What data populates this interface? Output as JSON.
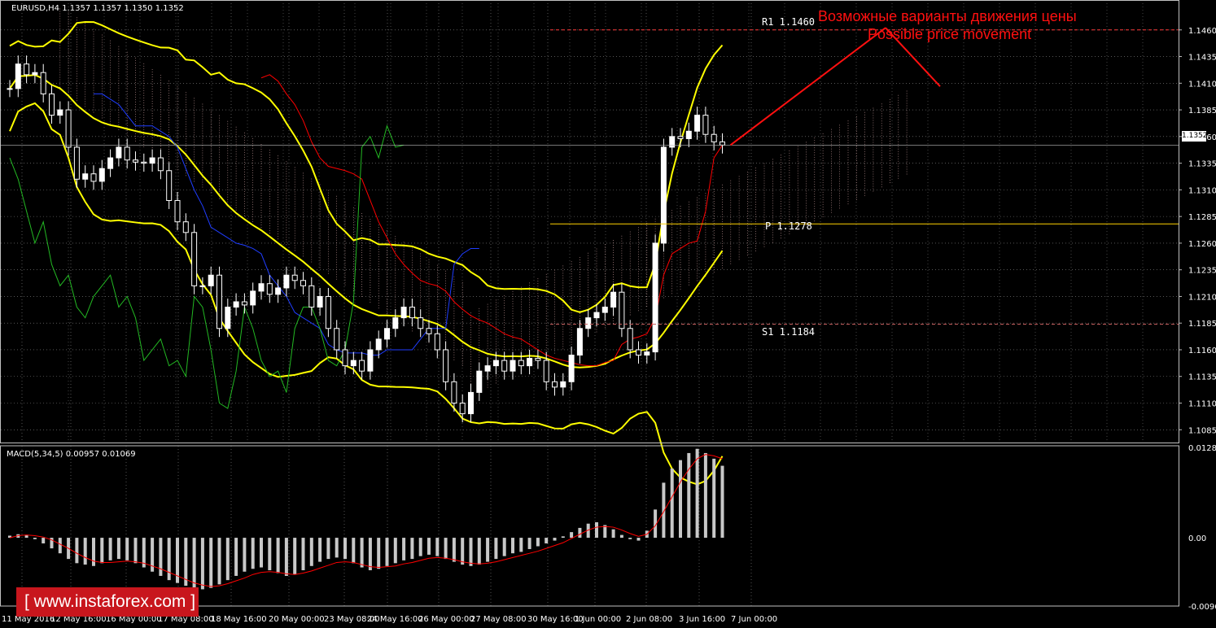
{
  "header": {
    "main": "EURUSD,H4  1.1357 1.1357 1.1350 1.1352",
    "macd": "MACD(5,34,5) 0.00957 0.01069"
  },
  "brand": "[ www.instaforex.com ]",
  "annotation": {
    "line1": "Возможные варианты движения цены",
    "line2": "Possible price movement"
  },
  "current_price": "1.1352",
  "levels": {
    "r1": "R1  1.1460",
    "p": "P  1.1278",
    "s1": "S1  1.1184"
  },
  "colors": {
    "bollinger": "#ffff00",
    "tenkan": "#ff0000",
    "kijun": "#1f3dff",
    "chikou": "#23b823",
    "candle": "#ffffff",
    "pivot": "#ffd200",
    "macd_hist": "#c8c8c8",
    "macd_signal": "#ff0000",
    "annotation": "#ff1010",
    "grid": "#8a8a8a"
  },
  "chart_data": [
    {
      "type": "candlestick",
      "symbol": "EURUSD",
      "timeframe": "H4",
      "ylim": [
        1.1073,
        1.1485
      ],
      "y_ticks": [
        "1.1460",
        "1.1435",
        "1.1410",
        "1.1385",
        "1.1360",
        "1.1335",
        "1.1310",
        "1.1285",
        "1.1260",
        "1.1235",
        "1.1210",
        "1.1185",
        "1.1160",
        "1.1135",
        "1.1110",
        "1.1085"
      ],
      "x_ticks": [
        "11 May 2016",
        "12 May 16:00",
        "16 May 00:00",
        "17 May 08:00",
        "18 May 16:00",
        "20 May 00:00",
        "23 May 08:00",
        "24 May 16:00",
        "26 May 00:00",
        "27 May 08:00",
        "30 May 16:00",
        "1 Jun 00:00",
        "2 Jun 08:00",
        "3 Jun 16:00",
        "7 Jun 00:00"
      ],
      "close": [
        1.1405,
        1.1428,
        1.1418,
        1.142,
        1.14,
        1.138,
        1.1385,
        1.135,
        1.132,
        1.1325,
        1.1318,
        1.133,
        1.134,
        1.135,
        1.1338,
        1.1336,
        1.1335,
        1.134,
        1.1328,
        1.13,
        1.128,
        1.127,
        1.122,
        1.122,
        1.123,
        1.118,
        1.12,
        1.1205,
        1.1202,
        1.1215,
        1.1222,
        1.1212,
        1.1218,
        1.123,
        1.1225,
        1.122,
        1.12,
        1.121,
        1.118,
        1.116,
        1.1145,
        1.115,
        1.114,
        1.116,
        1.117,
        1.118,
        1.119,
        1.12,
        1.119,
        1.118,
        1.1175,
        1.116,
        1.113,
        1.111,
        1.11,
        1.112,
        1.114,
        1.1145,
        1.115,
        1.114,
        1.115,
        1.1145,
        1.1152,
        1.115,
        1.113,
        1.1125,
        1.113,
        1.1155,
        1.118,
        1.119,
        1.1195,
        1.12,
        1.1214,
        1.118,
        1.116,
        1.1155,
        1.1158,
        1.126,
        1.135,
        1.136,
        1.1358,
        1.1365,
        1.138,
        1.1362,
        1.1355,
        1.1352
      ],
      "ichimoku_tenkan": [
        1.1415,
        1.1418,
        1.1412,
        1.14,
        1.139,
        1.1375,
        1.1355,
        1.134,
        1.1332,
        1.133,
        1.1328,
        1.1325,
        1.132,
        1.13,
        1.128,
        1.1265,
        1.125,
        1.124,
        1.1232,
        1.1225,
        1.1222,
        1.122,
        1.1215,
        1.1205,
        1.1198,
        1.1192,
        1.1188,
        1.1185,
        1.118,
        1.1175,
        1.1172,
        1.117,
        1.1165,
        1.116,
        1.1155,
        1.1152,
        1.115,
        1.1148,
        1.1146,
        1.1145,
        1.1145,
        1.1148,
        1.115,
        1.1165,
        1.117,
        1.1172,
        1.1175,
        1.119,
        1.123,
        1.125,
        1.1255,
        1.126,
        1.1262,
        1.129,
        1.134,
        1.1352
      ],
      "ichimoku_kijun": [
        1.14,
        1.14,
        1.1395,
        1.139,
        1.138,
        1.137,
        1.137,
        1.137,
        1.1365,
        1.136,
        1.135,
        1.133,
        1.131,
        1.1295,
        1.1275,
        1.127,
        1.1265,
        1.126,
        1.1258,
        1.1255,
        1.125,
        1.123,
        1.122,
        1.121,
        1.1195,
        1.119,
        1.1185,
        1.118,
        1.1165,
        1.116,
        1.1157,
        1.1157,
        1.1157,
        1.1155,
        1.1155,
        1.116,
        1.116,
        1.116,
        1.116,
        1.117,
        1.118,
        1.118,
        1.118,
        1.124,
        1.125,
        1.1255,
        1.1255
      ],
      "chikou_span": [
        1.134,
        1.132,
        1.129,
        1.126,
        1.128,
        1.124,
        1.122,
        1.123,
        1.12,
        1.119,
        1.121,
        1.122,
        1.123,
        1.12,
        1.121,
        1.119,
        1.115,
        1.116,
        1.117,
        1.1145,
        1.115,
        1.1135,
        1.121,
        1.12,
        1.116,
        1.111,
        1.1105,
        1.114,
        1.12,
        1.118,
        1.115,
        1.1135,
        1.114,
        1.112,
        1.118,
        1.12,
        1.12,
        1.118,
        1.115,
        1.1145,
        1.116,
        1.1205,
        1.135,
        1.136,
        1.134,
        1.137,
        1.135,
        1.1352
      ],
      "pivot_levels": {
        "R1": 1.146,
        "P": 1.1278,
        "S1": 1.1184
      },
      "projection": [
        [
          1.1352,
          1.1462
        ],
        [
          1.1462,
          1.1407
        ]
      ]
    },
    {
      "type": "bar",
      "name": "MACD(5,34,5)",
      "ylim": [
        -0.00967,
        0.0128
      ],
      "y_ticks": [
        "0.0128",
        "0.00",
        "-0.00967"
      ],
      "histogram": [
        0.0003,
        0.0005,
        0.0004,
        -0.0002,
        -0.0008,
        -0.0015,
        -0.0022,
        -0.003,
        -0.0036,
        -0.0038,
        -0.004,
        -0.0036,
        -0.0032,
        -0.003,
        -0.0032,
        -0.0036,
        -0.0042,
        -0.0048,
        -0.0054,
        -0.006,
        -0.0064,
        -0.0068,
        -0.0072,
        -0.0073,
        -0.0071,
        -0.0066,
        -0.006,
        -0.0054,
        -0.0048,
        -0.0044,
        -0.0042,
        -0.0046,
        -0.005,
        -0.0054,
        -0.0052,
        -0.0046,
        -0.004,
        -0.0034,
        -0.003,
        -0.0028,
        -0.003,
        -0.0036,
        -0.0042,
        -0.0046,
        -0.0044,
        -0.004,
        -0.0036,
        -0.0032,
        -0.003,
        -0.0026,
        -0.0024,
        -0.0026,
        -0.003,
        -0.0034,
        -0.0038,
        -0.004,
        -0.0038,
        -0.0034,
        -0.003,
        -0.0026,
        -0.0022,
        -0.002,
        -0.0016,
        -0.0012,
        -0.0008,
        -0.0004,
        0.0002,
        0.0008,
        0.0014,
        0.002,
        0.0022,
        0.0018,
        0.0012,
        0.0004,
        -0.0002,
        -0.0004,
        0.001,
        0.004,
        0.0078,
        0.0098,
        0.011,
        0.012,
        0.0126,
        0.012,
        0.0112,
        0.0102
      ],
      "signal": [
        0.0,
        0.0003,
        0.0004,
        0.0003,
        0.0001,
        -0.0003,
        -0.0009,
        -0.0015,
        -0.0022,
        -0.0028,
        -0.0033,
        -0.0035,
        -0.0035,
        -0.0034,
        -0.0033,
        -0.0034,
        -0.0036,
        -0.004,
        -0.0044,
        -0.0049,
        -0.0054,
        -0.0059,
        -0.0064,
        -0.0067,
        -0.0069,
        -0.0068,
        -0.0065,
        -0.0061,
        -0.0057,
        -0.0052,
        -0.0049,
        -0.0048,
        -0.0049,
        -0.0051,
        -0.0052,
        -0.005,
        -0.0047,
        -0.0043,
        -0.0039,
        -0.0035,
        -0.0034,
        -0.0035,
        -0.0038,
        -0.0041,
        -0.0042,
        -0.0041,
        -0.004,
        -0.0037,
        -0.0035,
        -0.0032,
        -0.0029,
        -0.0028,
        -0.0029,
        -0.0031,
        -0.0034,
        -0.0036,
        -0.0037,
        -0.0036,
        -0.0034,
        -0.0031,
        -0.0028,
        -0.0025,
        -0.0022,
        -0.0019,
        -0.0015,
        -0.0011,
        -0.0007,
        -0.0001,
        0.0005,
        0.0011,
        0.0015,
        0.0016,
        0.0015,
        0.0011,
        0.0006,
        0.0002,
        0.0005,
        0.0017,
        0.0037,
        0.0058,
        0.0079,
        0.0097,
        0.0112,
        0.0118,
        0.0116,
        0.0112
      ]
    }
  ]
}
